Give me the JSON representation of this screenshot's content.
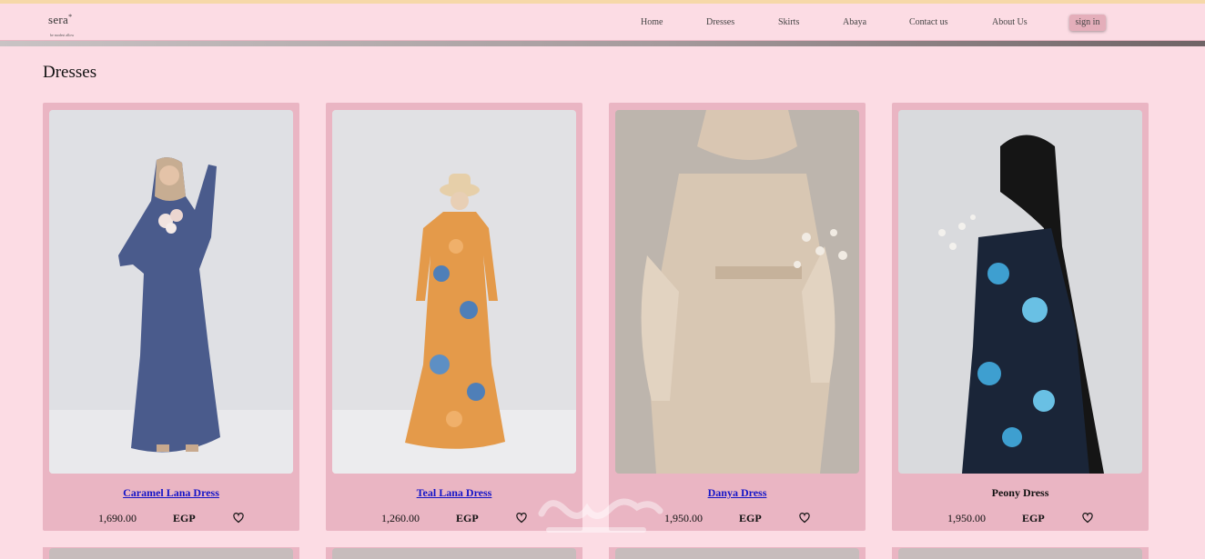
{
  "brand": {
    "name": "sera",
    "star": "*",
    "tagline": "be modest allow"
  },
  "nav": {
    "links": [
      "Home",
      "Dresses",
      "Skirts",
      "Abaya",
      "Contact us",
      "About Us"
    ],
    "signin": "sign in"
  },
  "page": {
    "title": "Dresses"
  },
  "products": [
    {
      "name": "Caramel Lana Dress",
      "price": "1,690.00",
      "currency": "EGP",
      "linked": true
    },
    {
      "name": "Teal Lana Dress",
      "price": "1,260.00",
      "currency": "EGP",
      "linked": true
    },
    {
      "name": "Danya Dress",
      "price": "1,950.00",
      "currency": "EGP",
      "linked": true
    },
    {
      "name": "Peony Dress",
      "price": "1,950.00",
      "currency": "EGP",
      "linked": false
    }
  ],
  "icons": {
    "wishlist": "heart-outline-icon"
  },
  "colors": {
    "background": "#fcdce4",
    "card": "#eab5c3",
    "link": "#1414c8",
    "signin_bg": "#e4aeba"
  }
}
